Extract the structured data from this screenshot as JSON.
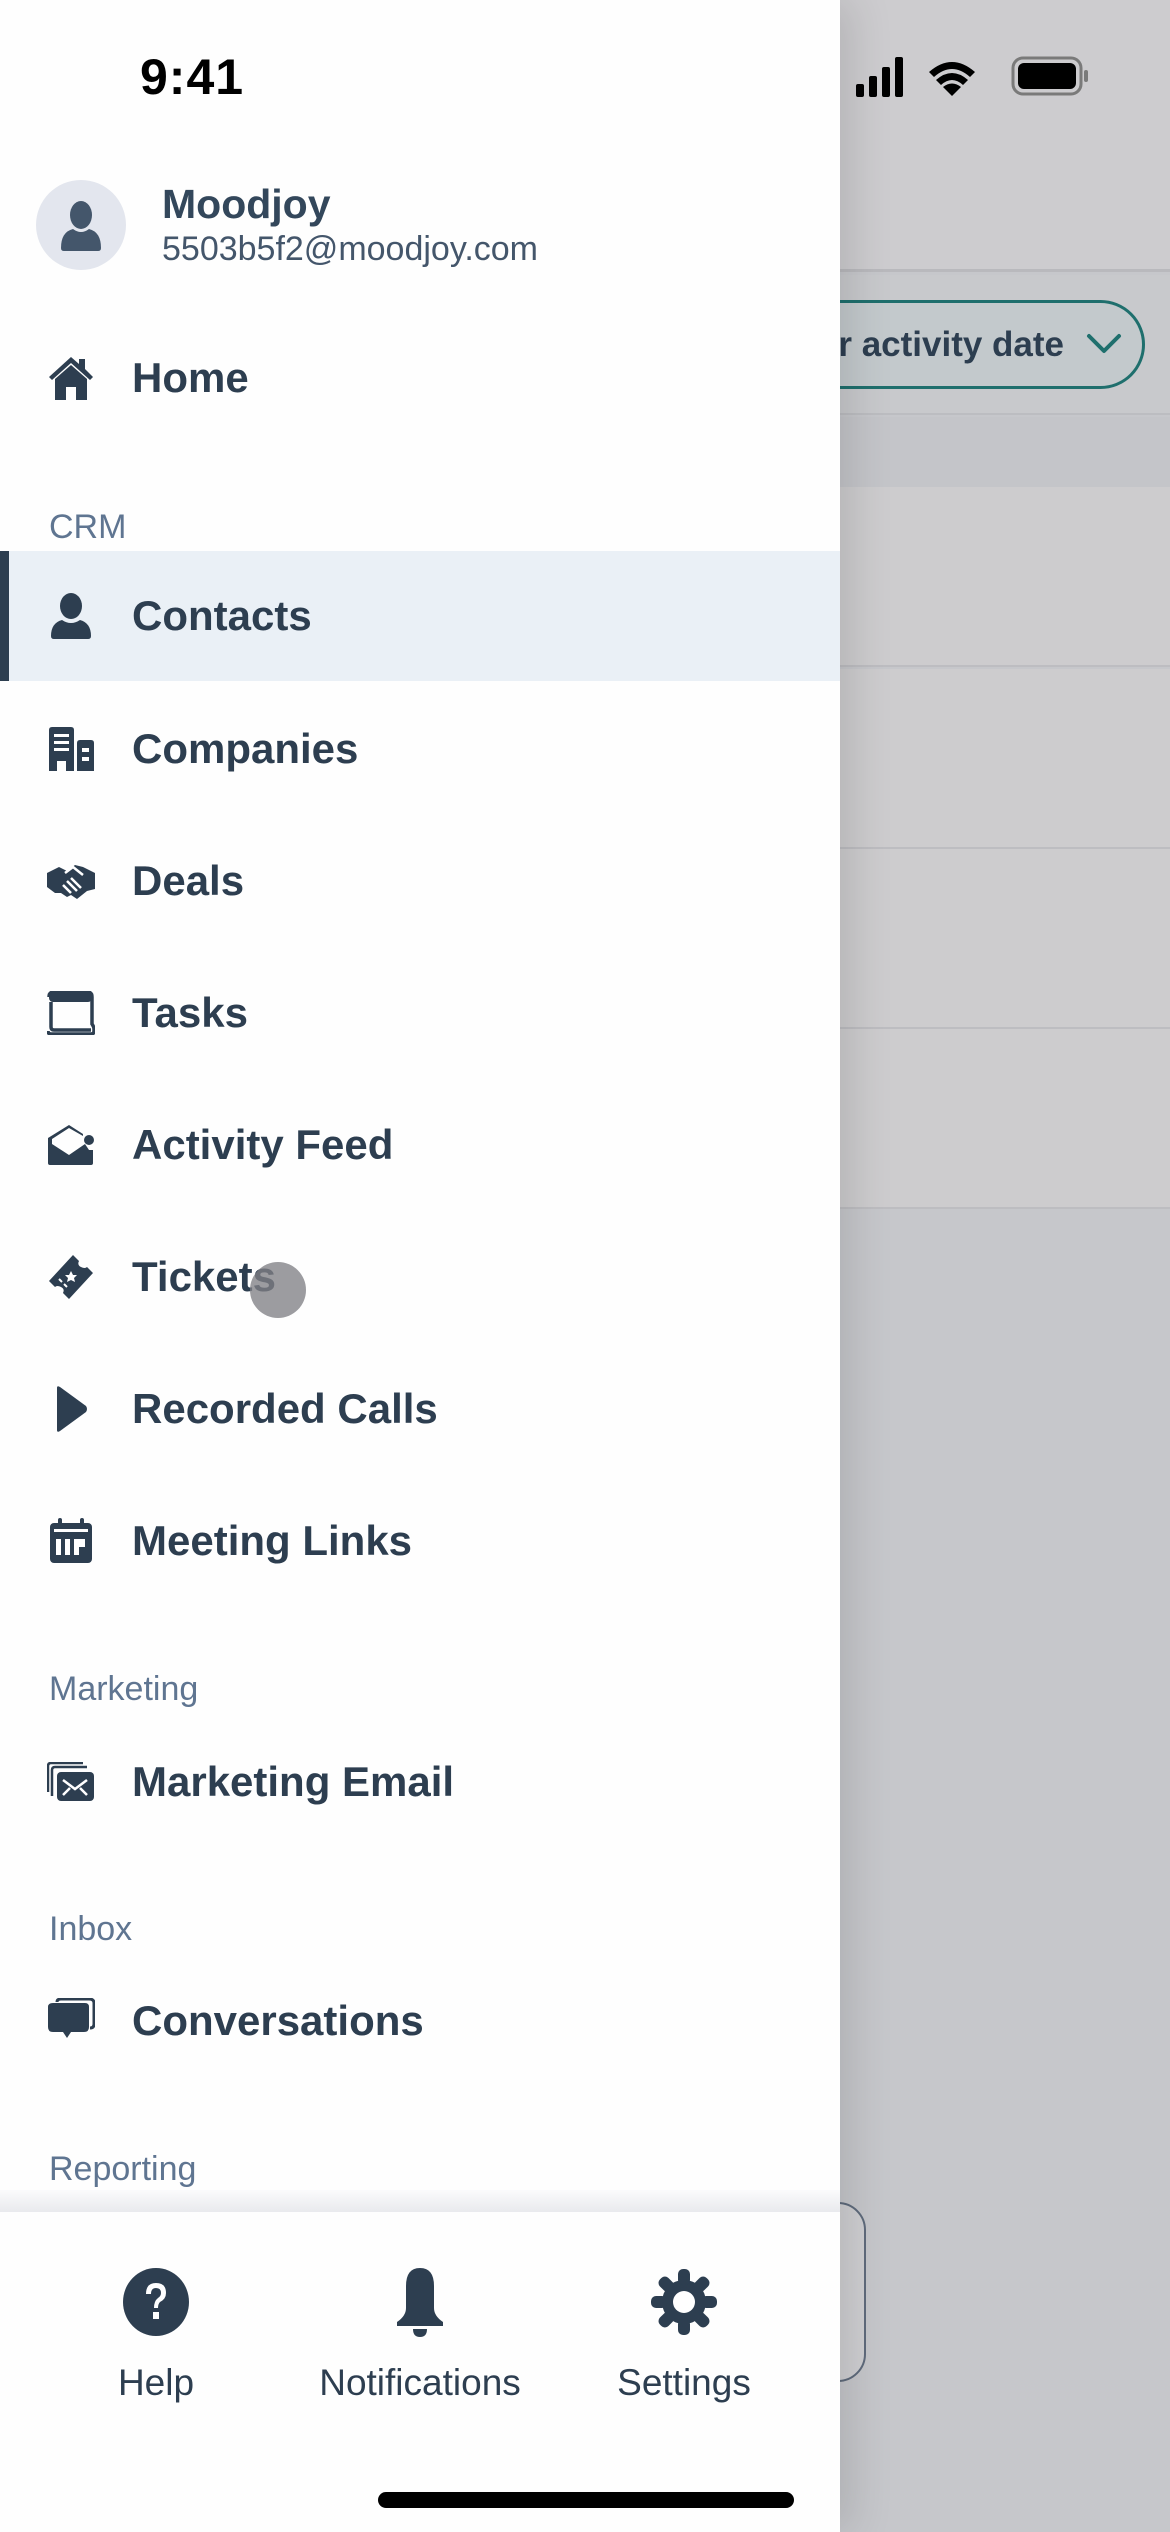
{
  "status_bar": {
    "time": "9:41",
    "icons": [
      "signal-icon",
      "wifi-icon",
      "battery-icon"
    ]
  },
  "background": {
    "filter_pill_label": "r activity date",
    "filter_pill_icon": "chevron-down-icon",
    "accent_color": "#1f6f6d"
  },
  "drawer": {
    "profile": {
      "name": "Moodjoy",
      "email": "5503b5f2@moodjoy.com",
      "avatar_icon": "user-avatar-icon"
    },
    "home": {
      "label": "Home",
      "icon": "home-icon"
    },
    "sections": [
      {
        "label": "CRM",
        "items": [
          {
            "label": "Contacts",
            "icon": "contact-person-icon",
            "active": true
          },
          {
            "label": "Companies",
            "icon": "building-icon",
            "active": false
          },
          {
            "label": "Deals",
            "icon": "handshake-icon",
            "active": false
          },
          {
            "label": "Tasks",
            "icon": "task-card-icon",
            "active": false
          },
          {
            "label": "Activity Feed",
            "icon": "activity-feed-icon",
            "active": false
          },
          {
            "label": "Tickets",
            "icon": "ticket-icon",
            "active": false
          },
          {
            "label": "Recorded Calls",
            "icon": "play-icon",
            "active": false
          },
          {
            "label": "Meeting Links",
            "icon": "calendar-icon",
            "active": false
          }
        ]
      },
      {
        "label": "Marketing",
        "items": [
          {
            "label": "Marketing Email",
            "icon": "stacked-email-icon",
            "active": false
          }
        ]
      },
      {
        "label": "Inbox",
        "items": [
          {
            "label": "Conversations",
            "icon": "chat-bubbles-icon",
            "active": false
          }
        ]
      },
      {
        "label": "Reporting",
        "items": []
      }
    ],
    "bottom_bar": [
      {
        "label": "Help",
        "icon": "help-circle-icon"
      },
      {
        "label": "Notifications",
        "icon": "bell-icon"
      },
      {
        "label": "Settings",
        "icon": "gear-icon"
      }
    ],
    "text_color": "#2d3e50",
    "section_label_color": "#5f7591",
    "active_bg_color": "#eaf0f6"
  }
}
